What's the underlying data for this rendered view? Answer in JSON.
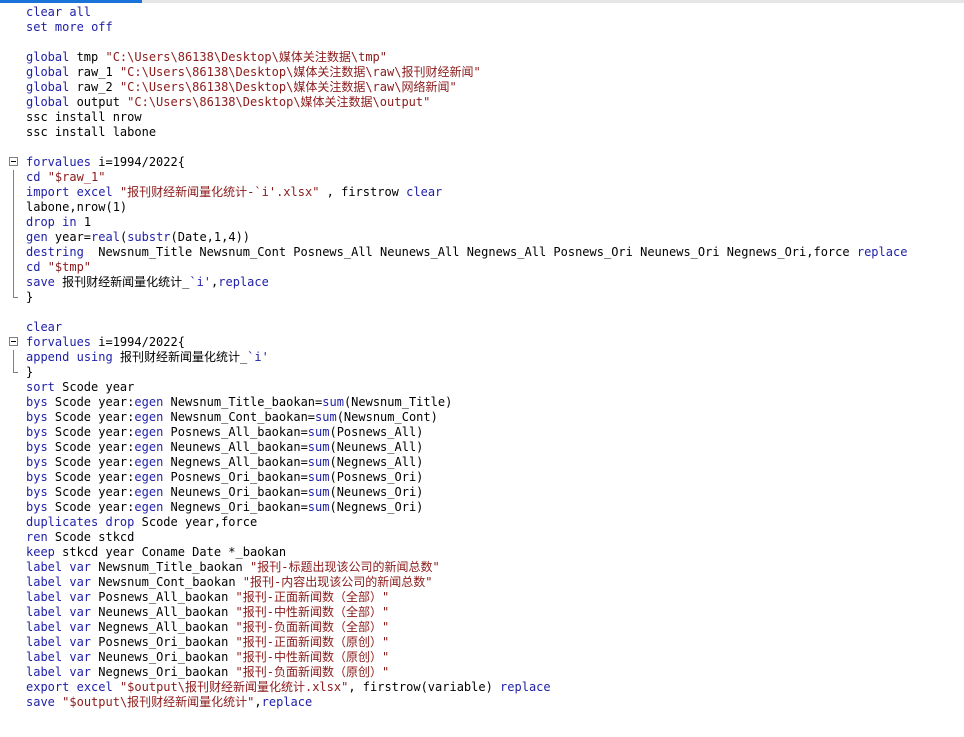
{
  "editor": {
    "lines": [
      {
        "fold": "",
        "tokens": [
          {
            "t": "kw",
            "v": "clear"
          },
          {
            "t": "plain",
            "v": " "
          },
          {
            "t": "kw",
            "v": "all"
          }
        ]
      },
      {
        "fold": "",
        "tokens": [
          {
            "t": "kw",
            "v": "set"
          },
          {
            "t": "plain",
            "v": " "
          },
          {
            "t": "kw",
            "v": "more"
          },
          {
            "t": "plain",
            "v": " "
          },
          {
            "t": "kw",
            "v": "off"
          }
        ]
      },
      {
        "fold": "",
        "tokens": []
      },
      {
        "fold": "",
        "tokens": [
          {
            "t": "kw",
            "v": "global"
          },
          {
            "t": "plain",
            "v": " tmp "
          },
          {
            "t": "str",
            "v": "\"C:\\Users\\86138\\Desktop\\媒体关注数据\\tmp\""
          }
        ]
      },
      {
        "fold": "",
        "tokens": [
          {
            "t": "kw",
            "v": "global"
          },
          {
            "t": "plain",
            "v": " raw_1 "
          },
          {
            "t": "str",
            "v": "\"C:\\Users\\86138\\Desktop\\媒体关注数据\\raw\\报刊财经新闻\""
          }
        ]
      },
      {
        "fold": "",
        "tokens": [
          {
            "t": "kw",
            "v": "global"
          },
          {
            "t": "plain",
            "v": " raw_2 "
          },
          {
            "t": "str",
            "v": "\"C:\\Users\\86138\\Desktop\\媒体关注数据\\raw\\网络新闻\""
          }
        ]
      },
      {
        "fold": "",
        "tokens": [
          {
            "t": "kw",
            "v": "global"
          },
          {
            "t": "plain",
            "v": " output "
          },
          {
            "t": "str",
            "v": "\"C:\\Users\\86138\\Desktop\\媒体关注数据\\output\""
          }
        ]
      },
      {
        "fold": "",
        "tokens": [
          {
            "t": "plain",
            "v": "ssc install nrow"
          }
        ]
      },
      {
        "fold": "",
        "tokens": [
          {
            "t": "plain",
            "v": "ssc install labone"
          }
        ]
      },
      {
        "fold": "",
        "tokens": []
      },
      {
        "fold": "start",
        "tokens": [
          {
            "t": "kw",
            "v": "forvalues"
          },
          {
            "t": "plain",
            "v": " i=1994/2022{"
          }
        ]
      },
      {
        "fold": "mid",
        "tokens": [
          {
            "t": "kw",
            "v": "cd"
          },
          {
            "t": "plain",
            "v": " "
          },
          {
            "t": "str",
            "v": "\"$raw_1\""
          }
        ]
      },
      {
        "fold": "mid",
        "tokens": [
          {
            "t": "kw",
            "v": "import"
          },
          {
            "t": "plain",
            "v": " "
          },
          {
            "t": "kw",
            "v": "excel"
          },
          {
            "t": "plain",
            "v": " "
          },
          {
            "t": "str",
            "v": "\"报刊财经新闻量化统计-`i'.xlsx\""
          },
          {
            "t": "plain",
            "v": " , firstrow "
          },
          {
            "t": "kw",
            "v": "clear"
          }
        ]
      },
      {
        "fold": "mid",
        "tokens": [
          {
            "t": "plain",
            "v": "labone,nrow(1)"
          }
        ]
      },
      {
        "fold": "mid",
        "tokens": [
          {
            "t": "kw",
            "v": "drop"
          },
          {
            "t": "plain",
            "v": " "
          },
          {
            "t": "kw",
            "v": "in"
          },
          {
            "t": "plain",
            "v": " 1"
          }
        ]
      },
      {
        "fold": "mid",
        "tokens": [
          {
            "t": "kw",
            "v": "gen"
          },
          {
            "t": "plain",
            "v": " year="
          },
          {
            "t": "func",
            "v": "real"
          },
          {
            "t": "plain",
            "v": "("
          },
          {
            "t": "func",
            "v": "substr"
          },
          {
            "t": "plain",
            "v": "(Date,1,4))"
          }
        ]
      },
      {
        "fold": "mid",
        "tokens": [
          {
            "t": "kw",
            "v": "destring"
          },
          {
            "t": "plain",
            "v": "  Newsnum_Title Newsnum_Cont Posnews_All Neunews_All Negnews_All Posnews_Ori Neunews_Ori Negnews_Ori,force "
          },
          {
            "t": "kw",
            "v": "replace"
          }
        ]
      },
      {
        "fold": "mid",
        "tokens": [
          {
            "t": "kw",
            "v": "cd"
          },
          {
            "t": "plain",
            "v": " "
          },
          {
            "t": "str",
            "v": "\"$tmp\""
          }
        ]
      },
      {
        "fold": "mid",
        "tokens": [
          {
            "t": "kw",
            "v": "save"
          },
          {
            "t": "plain",
            "v": " 报刊财经新闻量化统计_"
          },
          {
            "t": "kw",
            "v": "`i'"
          },
          {
            "t": "plain",
            "v": ","
          },
          {
            "t": "kw",
            "v": "replace"
          }
        ]
      },
      {
        "fold": "end",
        "tokens": [
          {
            "t": "plain",
            "v": "}"
          }
        ]
      },
      {
        "fold": "",
        "tokens": []
      },
      {
        "fold": "",
        "tokens": [
          {
            "t": "kw",
            "v": "clear"
          }
        ]
      },
      {
        "fold": "start",
        "tokens": [
          {
            "t": "kw",
            "v": "forvalues"
          },
          {
            "t": "plain",
            "v": " i=1994/2022{"
          }
        ]
      },
      {
        "fold": "mid",
        "tokens": [
          {
            "t": "kw",
            "v": "append"
          },
          {
            "t": "plain",
            "v": " "
          },
          {
            "t": "kw",
            "v": "using"
          },
          {
            "t": "plain",
            "v": " 报刊财经新闻量化统计_"
          },
          {
            "t": "kw",
            "v": "`i'"
          }
        ]
      },
      {
        "fold": "end",
        "tokens": [
          {
            "t": "plain",
            "v": "}"
          }
        ]
      },
      {
        "fold": "",
        "tokens": [
          {
            "t": "kw",
            "v": "sort"
          },
          {
            "t": "plain",
            "v": " Scode year"
          }
        ]
      },
      {
        "fold": "",
        "tokens": [
          {
            "t": "kw",
            "v": "bys"
          },
          {
            "t": "plain",
            "v": " Scode year:"
          },
          {
            "t": "kw",
            "v": "egen"
          },
          {
            "t": "plain",
            "v": " Newsnum_Title_baokan="
          },
          {
            "t": "func",
            "v": "sum"
          },
          {
            "t": "plain",
            "v": "(Newsnum_Title)"
          }
        ]
      },
      {
        "fold": "",
        "tokens": [
          {
            "t": "kw",
            "v": "bys"
          },
          {
            "t": "plain",
            "v": " Scode year:"
          },
          {
            "t": "kw",
            "v": "egen"
          },
          {
            "t": "plain",
            "v": " Newsnum_Cont_baokan="
          },
          {
            "t": "func",
            "v": "sum"
          },
          {
            "t": "plain",
            "v": "(Newsnum_Cont)"
          }
        ]
      },
      {
        "fold": "",
        "tokens": [
          {
            "t": "kw",
            "v": "bys"
          },
          {
            "t": "plain",
            "v": " Scode year:"
          },
          {
            "t": "kw",
            "v": "egen"
          },
          {
            "t": "plain",
            "v": " Posnews_All_baokan="
          },
          {
            "t": "func",
            "v": "sum"
          },
          {
            "t": "plain",
            "v": "(Posnews_All)"
          }
        ]
      },
      {
        "fold": "",
        "tokens": [
          {
            "t": "kw",
            "v": "bys"
          },
          {
            "t": "plain",
            "v": " Scode year:"
          },
          {
            "t": "kw",
            "v": "egen"
          },
          {
            "t": "plain",
            "v": " Neunews_All_baokan="
          },
          {
            "t": "func",
            "v": "sum"
          },
          {
            "t": "plain",
            "v": "(Neunews_All)"
          }
        ]
      },
      {
        "fold": "",
        "tokens": [
          {
            "t": "kw",
            "v": "bys"
          },
          {
            "t": "plain",
            "v": " Scode year:"
          },
          {
            "t": "kw",
            "v": "egen"
          },
          {
            "t": "plain",
            "v": " Negnews_All_baokan="
          },
          {
            "t": "func",
            "v": "sum"
          },
          {
            "t": "plain",
            "v": "(Negnews_All)"
          }
        ]
      },
      {
        "fold": "",
        "tokens": [
          {
            "t": "kw",
            "v": "bys"
          },
          {
            "t": "plain",
            "v": " Scode year:"
          },
          {
            "t": "kw",
            "v": "egen"
          },
          {
            "t": "plain",
            "v": " Posnews_Ori_baokan="
          },
          {
            "t": "func",
            "v": "sum"
          },
          {
            "t": "plain",
            "v": "(Posnews_Ori)"
          }
        ]
      },
      {
        "fold": "",
        "tokens": [
          {
            "t": "kw",
            "v": "bys"
          },
          {
            "t": "plain",
            "v": " Scode year:"
          },
          {
            "t": "kw",
            "v": "egen"
          },
          {
            "t": "plain",
            "v": " Neunews_Ori_baokan="
          },
          {
            "t": "func",
            "v": "sum"
          },
          {
            "t": "plain",
            "v": "(Neunews_Ori)"
          }
        ]
      },
      {
        "fold": "",
        "tokens": [
          {
            "t": "kw",
            "v": "bys"
          },
          {
            "t": "plain",
            "v": " Scode year:"
          },
          {
            "t": "kw",
            "v": "egen"
          },
          {
            "t": "plain",
            "v": " Negnews_Ori_baokan="
          },
          {
            "t": "func",
            "v": "sum"
          },
          {
            "t": "plain",
            "v": "(Negnews_Ori)"
          }
        ]
      },
      {
        "fold": "",
        "tokens": [
          {
            "t": "kw",
            "v": "duplicates"
          },
          {
            "t": "plain",
            "v": " "
          },
          {
            "t": "kw",
            "v": "drop"
          },
          {
            "t": "plain",
            "v": " Scode year,force"
          }
        ]
      },
      {
        "fold": "",
        "tokens": [
          {
            "t": "kw",
            "v": "ren"
          },
          {
            "t": "plain",
            "v": " Scode stkcd"
          }
        ]
      },
      {
        "fold": "",
        "tokens": [
          {
            "t": "kw",
            "v": "keep"
          },
          {
            "t": "plain",
            "v": " stkcd year Coname Date *_baokan"
          }
        ]
      },
      {
        "fold": "",
        "tokens": [
          {
            "t": "kw",
            "v": "label"
          },
          {
            "t": "plain",
            "v": " "
          },
          {
            "t": "kw",
            "v": "var"
          },
          {
            "t": "plain",
            "v": " Newsnum_Title_baokan "
          },
          {
            "t": "str",
            "v": "\"报刊-标题出现该公司的新闻总数\""
          }
        ]
      },
      {
        "fold": "",
        "tokens": [
          {
            "t": "kw",
            "v": "label"
          },
          {
            "t": "plain",
            "v": " "
          },
          {
            "t": "kw",
            "v": "var"
          },
          {
            "t": "plain",
            "v": " Newsnum_Cont_baokan "
          },
          {
            "t": "str",
            "v": "\"报刊-内容出现该公司的新闻总数\""
          }
        ]
      },
      {
        "fold": "",
        "tokens": [
          {
            "t": "kw",
            "v": "label"
          },
          {
            "t": "plain",
            "v": " "
          },
          {
            "t": "kw",
            "v": "var"
          },
          {
            "t": "plain",
            "v": " Posnews_All_baokan "
          },
          {
            "t": "str",
            "v": "\"报刊-正面新闻数（全部）\""
          }
        ]
      },
      {
        "fold": "",
        "tokens": [
          {
            "t": "kw",
            "v": "label"
          },
          {
            "t": "plain",
            "v": " "
          },
          {
            "t": "kw",
            "v": "var"
          },
          {
            "t": "plain",
            "v": " Neunews_All_baokan "
          },
          {
            "t": "str",
            "v": "\"报刊-中性新闻数（全部）\""
          }
        ]
      },
      {
        "fold": "",
        "tokens": [
          {
            "t": "kw",
            "v": "label"
          },
          {
            "t": "plain",
            "v": " "
          },
          {
            "t": "kw",
            "v": "var"
          },
          {
            "t": "plain",
            "v": " Negnews_All_baokan "
          },
          {
            "t": "str",
            "v": "\"报刊-负面新闻数（全部）\""
          }
        ]
      },
      {
        "fold": "",
        "tokens": [
          {
            "t": "kw",
            "v": "label"
          },
          {
            "t": "plain",
            "v": " "
          },
          {
            "t": "kw",
            "v": "var"
          },
          {
            "t": "plain",
            "v": " Posnews_Ori_baokan "
          },
          {
            "t": "str",
            "v": "\"报刊-正面新闻数（原创）\""
          }
        ]
      },
      {
        "fold": "",
        "tokens": [
          {
            "t": "kw",
            "v": "label"
          },
          {
            "t": "plain",
            "v": " "
          },
          {
            "t": "kw",
            "v": "var"
          },
          {
            "t": "plain",
            "v": " Neunews_Ori_baokan "
          },
          {
            "t": "str",
            "v": "\"报刊-中性新闻数（原创）\""
          }
        ]
      },
      {
        "fold": "",
        "tokens": [
          {
            "t": "kw",
            "v": "label"
          },
          {
            "t": "plain",
            "v": " "
          },
          {
            "t": "kw",
            "v": "var"
          },
          {
            "t": "plain",
            "v": " Negnews_Ori_baokan "
          },
          {
            "t": "str",
            "v": "\"报刊-负面新闻数（原创）\""
          }
        ]
      },
      {
        "fold": "",
        "tokens": [
          {
            "t": "kw",
            "v": "export"
          },
          {
            "t": "plain",
            "v": " "
          },
          {
            "t": "kw",
            "v": "excel"
          },
          {
            "t": "plain",
            "v": " "
          },
          {
            "t": "str",
            "v": "\"$output\\报刊财经新闻量化统计.xlsx\""
          },
          {
            "t": "plain",
            "v": ", firstrow(variable) "
          },
          {
            "t": "kw",
            "v": "replace"
          }
        ]
      },
      {
        "fold": "",
        "tokens": [
          {
            "t": "kw",
            "v": "save"
          },
          {
            "t": "plain",
            "v": " "
          },
          {
            "t": "str",
            "v": "\"$output\\报刊财经新闻量化统计\""
          },
          {
            "t": "plain",
            "v": ","
          },
          {
            "t": "kw",
            "v": "replace"
          }
        ]
      }
    ]
  },
  "colors": {
    "keyword": "#1e1ea8",
    "string": "#8b1a1a",
    "text": "#000000",
    "scroll_thumb": "#1a73d9"
  }
}
